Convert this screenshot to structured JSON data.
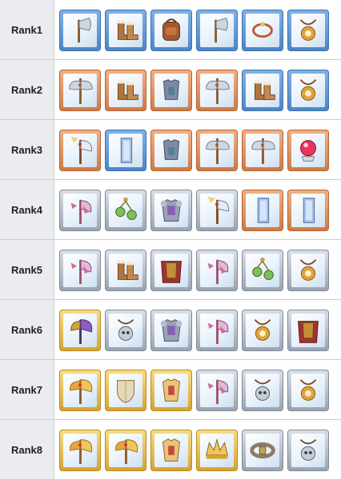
{
  "ranks": [
    {
      "label": "Rank1",
      "items": [
        {
          "name": "axe-icon",
          "frame": "blue"
        },
        {
          "name": "boots-icon",
          "frame": "blue"
        },
        {
          "name": "backpack-icon",
          "frame": "blue"
        },
        {
          "name": "axe-icon",
          "frame": "blue"
        },
        {
          "name": "bracelet-icon",
          "frame": "blue"
        },
        {
          "name": "amulet-icon",
          "frame": "blue"
        }
      ]
    },
    {
      "label": "Rank2",
      "items": [
        {
          "name": "battle-axe-icon",
          "frame": "bronze"
        },
        {
          "name": "boots-icon",
          "frame": "bronze"
        },
        {
          "name": "armor-icon",
          "frame": "bronze"
        },
        {
          "name": "battle-axe-icon",
          "frame": "bronze"
        },
        {
          "name": "boots-icon",
          "frame": "blue"
        },
        {
          "name": "amulet-icon",
          "frame": "blue"
        }
      ]
    },
    {
      "label": "Rank3",
      "items": [
        {
          "name": "feather-axe-icon",
          "frame": "bronze"
        },
        {
          "name": "crystal-icon",
          "frame": "blue"
        },
        {
          "name": "armor-icon",
          "frame": "bronze"
        },
        {
          "name": "battle-axe-icon",
          "frame": "bronze"
        },
        {
          "name": "battle-axe-icon",
          "frame": "bronze"
        },
        {
          "name": "orb-icon",
          "frame": "bronze"
        }
      ]
    },
    {
      "label": "Rank4",
      "items": [
        {
          "name": "ribbon-axe-icon",
          "frame": "silver"
        },
        {
          "name": "earring-icon",
          "frame": "silver"
        },
        {
          "name": "heavy-armor-icon",
          "frame": "silver"
        },
        {
          "name": "feather-axe-icon",
          "frame": "silver"
        },
        {
          "name": "crystal-icon",
          "frame": "bronze"
        },
        {
          "name": "crystal-icon",
          "frame": "bronze"
        }
      ]
    },
    {
      "label": "Rank5",
      "items": [
        {
          "name": "ribbon-axe-icon",
          "frame": "silver"
        },
        {
          "name": "boots-icon",
          "frame": "silver"
        },
        {
          "name": "cape-armor-icon",
          "frame": "silver"
        },
        {
          "name": "ribbon-axe-icon",
          "frame": "silver"
        },
        {
          "name": "earring-icon",
          "frame": "silver"
        },
        {
          "name": "amulet-icon",
          "frame": "silver"
        }
      ]
    },
    {
      "label": "Rank6",
      "items": [
        {
          "name": "purple-axe-icon",
          "frame": "gold"
        },
        {
          "name": "skull-pendant-icon",
          "frame": "silver"
        },
        {
          "name": "heavy-armor-icon",
          "frame": "silver"
        },
        {
          "name": "ribbon-axe-icon",
          "frame": "silver"
        },
        {
          "name": "amulet-icon",
          "frame": "silver"
        },
        {
          "name": "cape-armor-icon",
          "frame": "silver"
        }
      ]
    },
    {
      "label": "Rank7",
      "items": [
        {
          "name": "gold-axe-icon",
          "frame": "gold"
        },
        {
          "name": "shield-icon",
          "frame": "gold"
        },
        {
          "name": "gold-armor-icon",
          "frame": "gold"
        },
        {
          "name": "ribbon-axe-icon",
          "frame": "silver"
        },
        {
          "name": "skull-pendant-icon",
          "frame": "silver"
        },
        {
          "name": "amulet-icon",
          "frame": "silver"
        }
      ]
    },
    {
      "label": "Rank8",
      "items": [
        {
          "name": "gold-axe-icon",
          "frame": "gold"
        },
        {
          "name": "gold-axe-icon",
          "frame": "gold"
        },
        {
          "name": "gold-armor-icon",
          "frame": "gold"
        },
        {
          "name": "crown-icon",
          "frame": "gold"
        },
        {
          "name": "belt-icon",
          "frame": "silver"
        },
        {
          "name": "skull-pendant-icon",
          "frame": "silver"
        }
      ]
    }
  ],
  "colors": {
    "label_bg": "#eaecf0",
    "grid_line": "#c8ccd1",
    "blue": "#4c86c8",
    "bronze": "#cf7a47",
    "silver": "#9aa4b1",
    "gold": "#d6a332"
  }
}
